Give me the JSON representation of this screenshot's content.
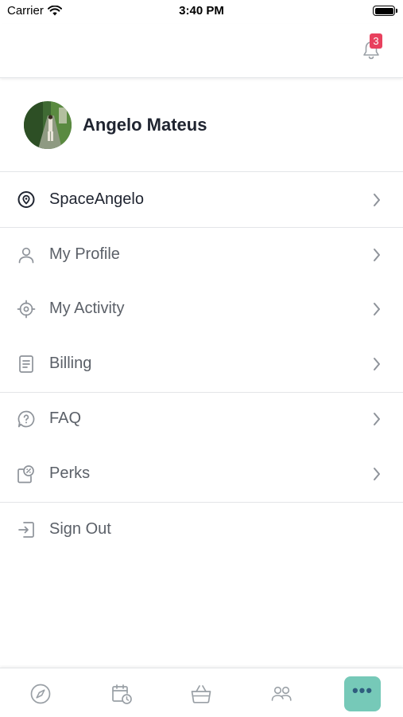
{
  "status_bar": {
    "carrier": "Carrier",
    "time": "3:40 PM",
    "battery_level": 1.0
  },
  "header": {
    "notification_count": "3",
    "badge_color": "#e8415e"
  },
  "profile": {
    "name": "Angelo Mateus"
  },
  "menu": {
    "space": {
      "label": "SpaceAngelo",
      "icon": "location-pin-icon"
    },
    "my_profile": {
      "label": "My Profile",
      "icon": "person-icon"
    },
    "my_activity": {
      "label": "My Activity",
      "icon": "crosshair-icon"
    },
    "billing": {
      "label": "Billing",
      "icon": "document-icon"
    },
    "faq": {
      "label": "FAQ",
      "icon": "question-bubble-icon"
    },
    "perks": {
      "label": "Perks",
      "icon": "coupon-icon"
    },
    "sign_out": {
      "label": "Sign Out",
      "icon": "sign-out-icon"
    }
  },
  "tab_bar": {
    "tabs": [
      {
        "icon": "compass-icon"
      },
      {
        "icon": "calendar-clock-icon"
      },
      {
        "icon": "basket-icon"
      },
      {
        "icon": "people-icon"
      },
      {
        "icon": "more-dots-icon",
        "active": true
      }
    ],
    "more_label": "•••",
    "accent_color": "#76c9b8"
  }
}
